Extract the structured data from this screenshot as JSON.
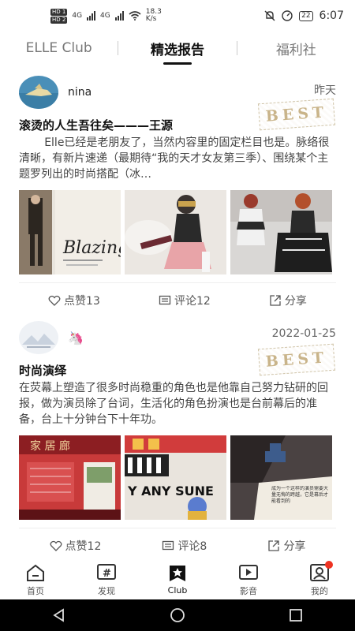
{
  "status_bar": {
    "hd1": "HD 1",
    "hd2": "HD 2",
    "net1": "4G",
    "net2": "4G",
    "speed": "18.3 K/s",
    "battery": "22",
    "time": "6:07"
  },
  "top_tabs": [
    "ELLE Club",
    "精选报告",
    "福利社"
  ],
  "posts": [
    {
      "username": "nina",
      "time": "昨天",
      "badge": "BEST",
      "title": "滚烫的人生吾往矣———王源",
      "body": "Elle已经是老朋友了，当然内容里的固定栏目也是。脉络很清晰，有新片速递（最期待“我的天才女友第三季）、围绕某个主题罗列出的时尚搭配（冰…",
      "like_label": "点赞13",
      "comment_label": "评论12",
      "share_label": "分享"
    },
    {
      "username": "",
      "time": "2022-01-25",
      "badge": "BEST",
      "title": "时尚演绎",
      "body": "在荧幕上塑造了很多时尚稳重的角色也是他靠自己努力钻研的回报，做为演员除了台词，生活化的角色扮演也是台前幕后的准备，台上十分钟台下十年功。",
      "like_label": "点赞12",
      "comment_label": "评论8",
      "share_label": "分享"
    }
  ],
  "image_text": {
    "magazine_cover_text": "Blazing",
    "shop_sign": "家 居 廊",
    "sign_words": "Y ANY SUNE",
    "book_text": "成为一个这样的演员需要大量无悔的跨越，它是幕后才能看到的"
  },
  "bottom_nav": [
    {
      "label": "首页",
      "icon": "home-icon"
    },
    {
      "label": "发现",
      "icon": "discover-icon"
    },
    {
      "label": "Club",
      "icon": "club-icon"
    },
    {
      "label": "影音",
      "icon": "video-icon"
    },
    {
      "label": "我的",
      "icon": "profile-icon"
    }
  ],
  "colors": {
    "badge": "#c9b48a",
    "active_text": "#111111",
    "notification_dot": "#ee3322"
  }
}
